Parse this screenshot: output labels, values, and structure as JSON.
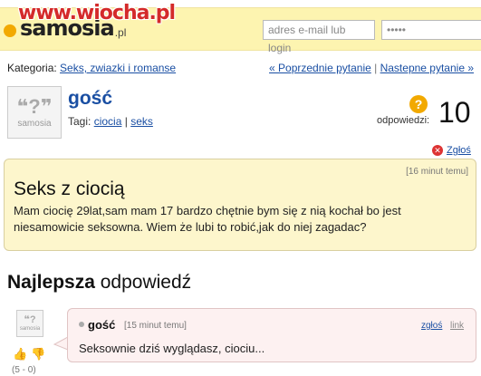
{
  "header": {
    "logo_text": "samosia",
    "logo_suffix": ".pl",
    "watermark": "www.wiocha.pl",
    "email_placeholder": "adres e-mail lub login",
    "password_value": "•••••"
  },
  "category": {
    "label": "Kategoria:",
    "link": "Seks, zwiazki i romanse"
  },
  "nav": {
    "prev": "« Poprzednie pytanie",
    "separator": "|",
    "next": "Nastepne pytanie »"
  },
  "question": {
    "user": "gość",
    "tags_label": "Tagi:",
    "tags": [
      "ciocia",
      "seks"
    ],
    "answers_label": "odpowiedzi:",
    "answers_count": "10",
    "report": "Zgłoś",
    "time": "[16 minut temu]",
    "title": "Seks z ciocią",
    "body": "Mam ciocię 29lat,sam mam 17 bardzo chętnie bym się z nią kochał bo jest niesamowicie seksowna. Wiem że lubi to robić,jak do niej zagadac?"
  },
  "best_answer": {
    "heading_bold": "Najlepsza",
    "heading_rest": " odpowiedź",
    "user": "gość",
    "time": "[15 minut temu]",
    "report": "zgłoś",
    "link": "link",
    "body": "Seksownie dziś wyglądasz, ciociu...",
    "score": "(5 - 0)"
  },
  "avatar_brand": "samosia"
}
